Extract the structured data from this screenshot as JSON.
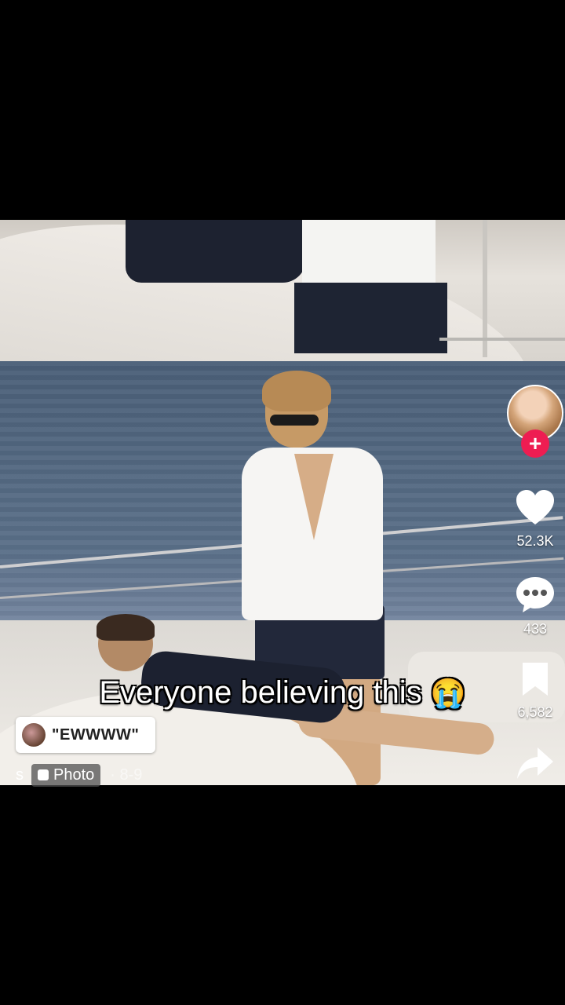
{
  "video": {
    "caption": "Everyone believing this",
    "caption_emoji": "😭"
  },
  "comment_pill": {
    "text": "\"EWWWW\""
  },
  "meta": {
    "author_initial": "s",
    "photo_label": "Photo",
    "page_count": "· 8-9"
  },
  "actions": {
    "likes": "52.3K",
    "comments": "433",
    "saves": "6,582"
  },
  "follow_symbol": "+",
  "colors": {
    "accent": "#ee1d52",
    "background": "#000000"
  }
}
